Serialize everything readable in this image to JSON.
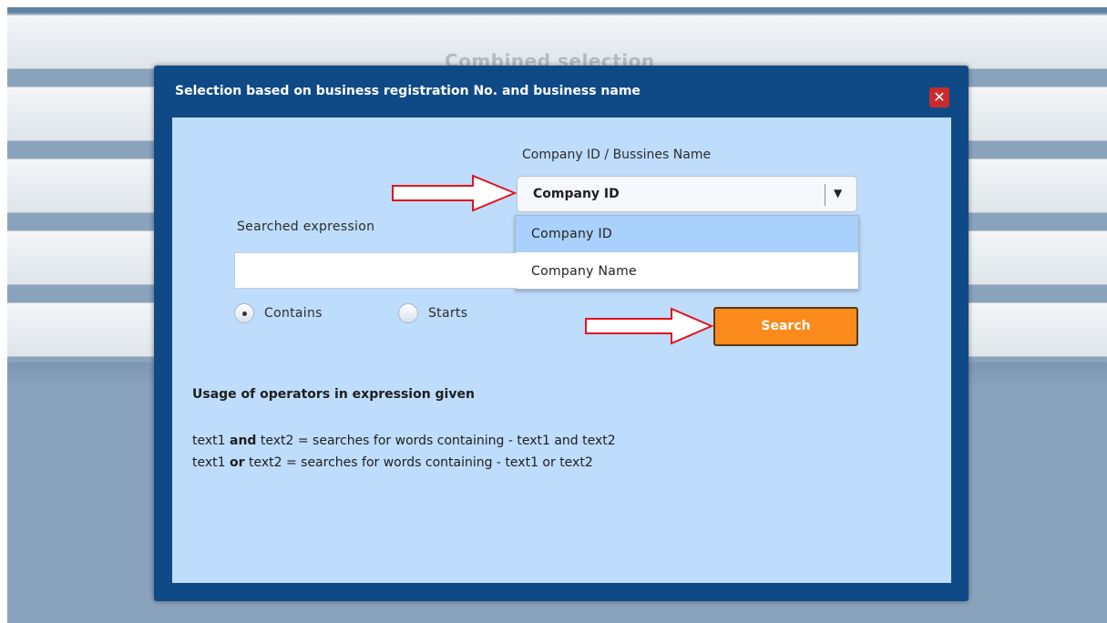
{
  "background": {
    "title": "Combined selection"
  },
  "modal": {
    "title": "Selection based on business registration No. and business name",
    "close_icon": "close-icon"
  },
  "form": {
    "combo_label": "Company ID / Bussines Name",
    "select": {
      "value": "Company ID",
      "options": [
        "Company ID",
        "Company Name"
      ],
      "highlighted_option": "Company ID"
    },
    "expression_label": "Searched expression",
    "expression_value": "",
    "radios": [
      {
        "label": "Contains",
        "checked": true
      },
      {
        "label": "Starts",
        "checked": false
      }
    ],
    "search_label": "Search"
  },
  "usage": {
    "title": "Usage of operators in expression given",
    "lines": [
      {
        "pre": "text1 ",
        "op": "and",
        "post": " text2 = searches for words containing - text1 and text2"
      },
      {
        "pre": "text1 ",
        "op": "or",
        "post": " text2 = searches for words containing - text1 or text2"
      }
    ]
  },
  "colors": {
    "modal_frame": "#0f4a86",
    "modal_body": "#bedcfb",
    "search_button": "#fb8a1c",
    "close_button": "#c92b2b",
    "annotation_arrow": "#e0141e"
  }
}
